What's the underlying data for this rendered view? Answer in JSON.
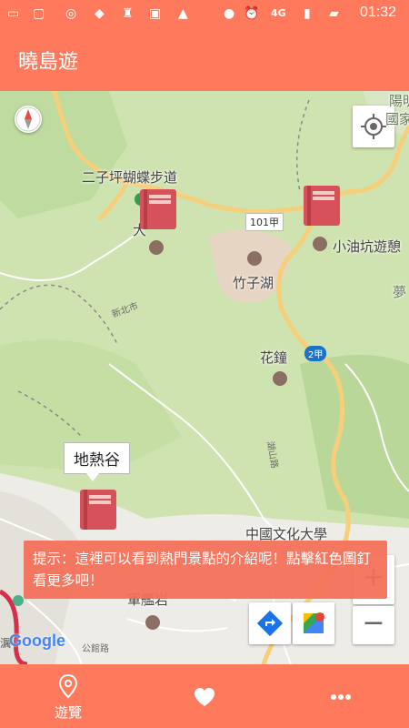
{
  "status_bar": {
    "time": "01:32",
    "network": "4G"
  },
  "app_bar": {
    "title": "曉島遊"
  },
  "map": {
    "labels": {
      "trail": "二子坪蝴蝶步道",
      "da": "大",
      "xiaoyoukeng": "小油坑遊憩",
      "zhuzihu": "竹子湖",
      "huazhong": "花鐘",
      "dirregu": "地熱谷",
      "culture_univ": "中國文化大學",
      "junjianyan": "軍艦岩",
      "yangming": "陽明",
      "guojia": "國家",
      "meng": "夢"
    },
    "road_badges": {
      "r101": "101甲",
      "r2": "2甲"
    },
    "small_labels": {
      "xinbei": "新北市",
      "hushan": "湖山路",
      "gongyuan": "公館路"
    },
    "callout": "地熱谷",
    "google_logo": "Google",
    "logo_prefix": "濿"
  },
  "toast": {
    "text": "提示：這裡可以看到熱門景點的介紹呢！點擊紅色圖釘看更多吧！"
  },
  "bottom_nav": {
    "items": [
      {
        "label": "遊覽",
        "icon": "location-pin-icon"
      },
      {
        "label": "",
        "icon": "heart-icon"
      },
      {
        "label": "",
        "icon": "more-icon"
      }
    ]
  },
  "colors": {
    "primary": "#ff7a5c",
    "book_red": "#d6515a",
    "map_green": "#cfe3b0"
  }
}
